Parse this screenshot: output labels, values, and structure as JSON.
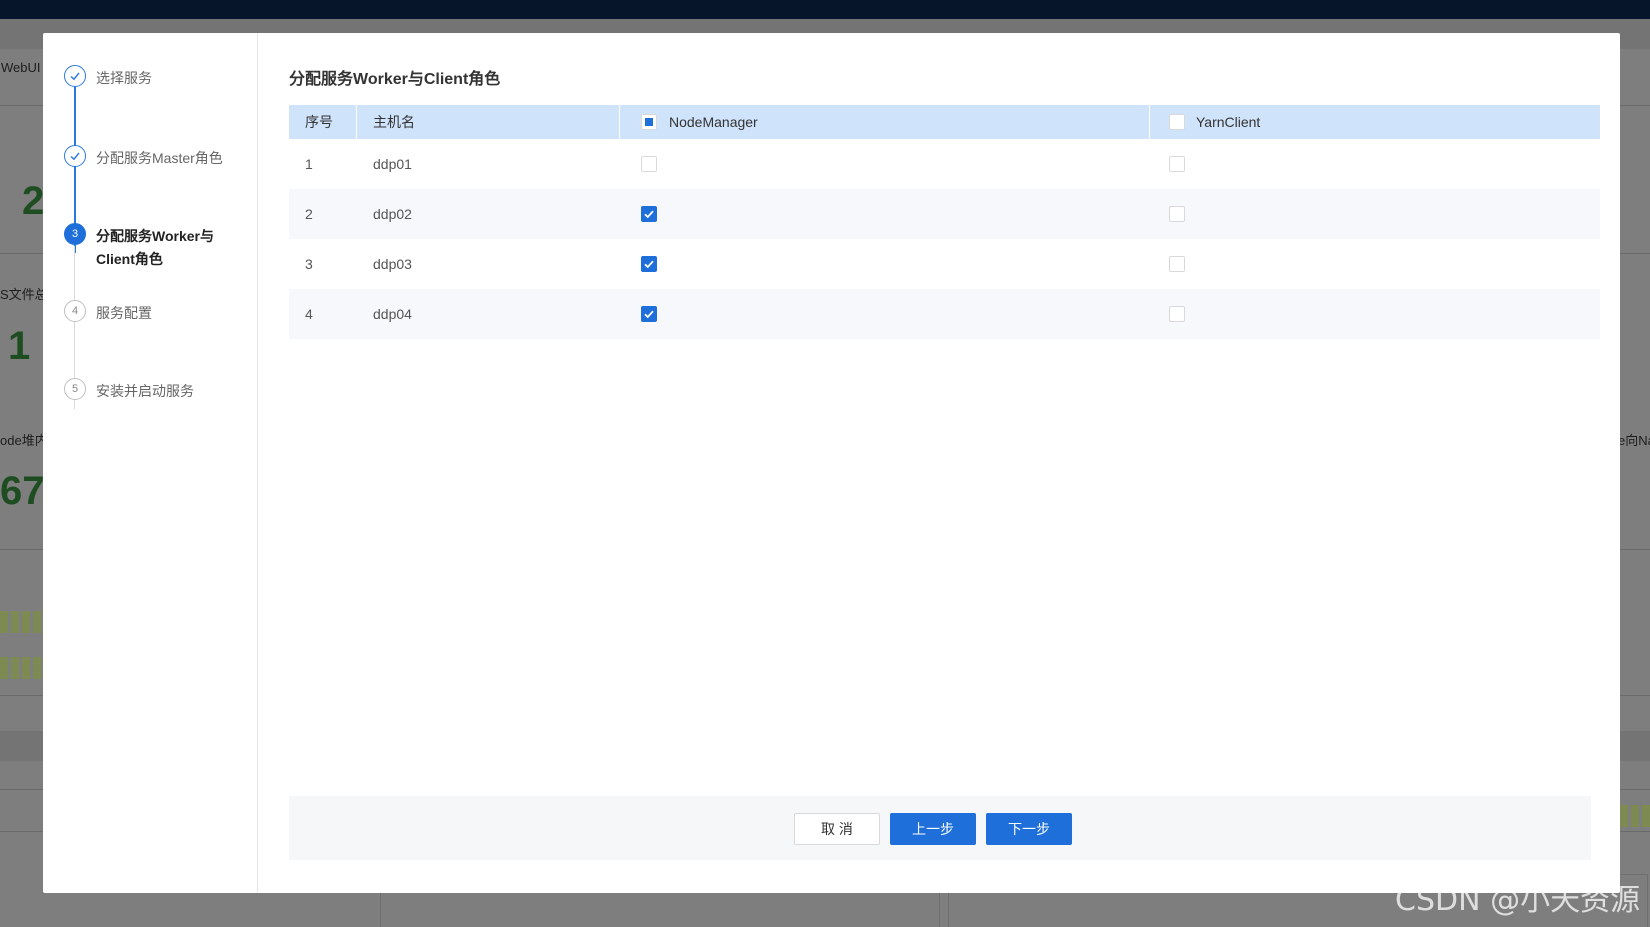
{
  "background": {
    "labels": [
      "WebUI",
      "S文件总",
      "ode堆内",
      "e向Na"
    ],
    "numbers": [
      "2",
      "1",
      "67"
    ]
  },
  "steps": [
    {
      "index": "1",
      "label": "选择服务",
      "state": "done"
    },
    {
      "index": "2",
      "label": "分配服务Master角色",
      "state": "done"
    },
    {
      "index": "3",
      "label": "分配服务Worker与Client角色",
      "state": "active"
    },
    {
      "index": "4",
      "label": "服务配置",
      "state": "pending"
    },
    {
      "index": "5",
      "label": "安装并启动服务",
      "state": "pending"
    }
  ],
  "content": {
    "title": "分配服务Worker与Client角色"
  },
  "table": {
    "headers": {
      "index": "序号",
      "host": "主机名",
      "node_manager": "NodeManager",
      "yarn_client": "YarnClient"
    },
    "header_checkbox_state": {
      "node_manager": "partial",
      "yarn_client": "unchecked"
    },
    "rows": [
      {
        "index": "1",
        "host": "ddp01",
        "node_manager": false,
        "yarn_client": false
      },
      {
        "index": "2",
        "host": "ddp02",
        "node_manager": true,
        "yarn_client": false
      },
      {
        "index": "3",
        "host": "ddp03",
        "node_manager": true,
        "yarn_client": false
      },
      {
        "index": "4",
        "host": "ddp04",
        "node_manager": true,
        "yarn_client": false
      }
    ]
  },
  "footer": {
    "cancel_label": "取 消",
    "prev_label": "上一步",
    "next_label": "下一步"
  },
  "watermark": "CSDN @小天资源",
  "colors": {
    "primary": "#1e6fd9",
    "header_bg": "#cfe3fb",
    "topbar": "#07152a"
  },
  "icons": {
    "done_step": "check-icon",
    "checked_box": "checkmark-icon"
  }
}
